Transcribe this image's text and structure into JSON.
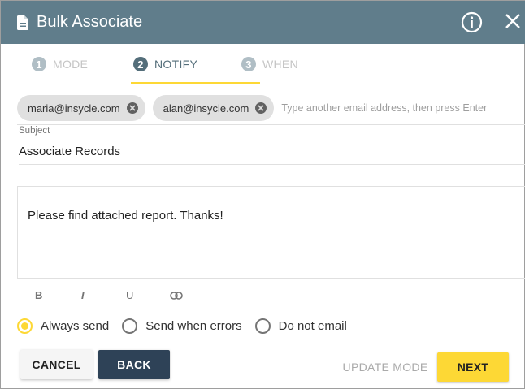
{
  "header": {
    "title": "Bulk Associate",
    "icon": "document-icon",
    "info_icon": "info-icon",
    "close_icon": "close-icon"
  },
  "steps": [
    {
      "num": "1",
      "label": "MODE",
      "active": false
    },
    {
      "num": "2",
      "label": "NOTIFY",
      "active": true
    },
    {
      "num": "3",
      "label": "WHEN",
      "active": false
    }
  ],
  "recipients": {
    "chips": [
      "maria@insycle.com",
      "alan@insycle.com"
    ],
    "placeholder": "Type another email address, then press Enter"
  },
  "subject": {
    "label": "Subject",
    "value": "Associate Records"
  },
  "body": {
    "value": "Please find attached report. Thanks!"
  },
  "format": {
    "bold": "B",
    "italic": "I",
    "underline": "U"
  },
  "send_options": {
    "options": [
      "Always send",
      "Send when errors",
      "Do not email"
    ],
    "selected": "Always send"
  },
  "buttons": {
    "cancel": "CANCEL",
    "back": "BACK",
    "update_mode": "UPDATE MODE",
    "next": "NEXT"
  },
  "colors": {
    "header": "#607d8b",
    "accent": "#fdd835",
    "back_button": "#2e4257"
  }
}
